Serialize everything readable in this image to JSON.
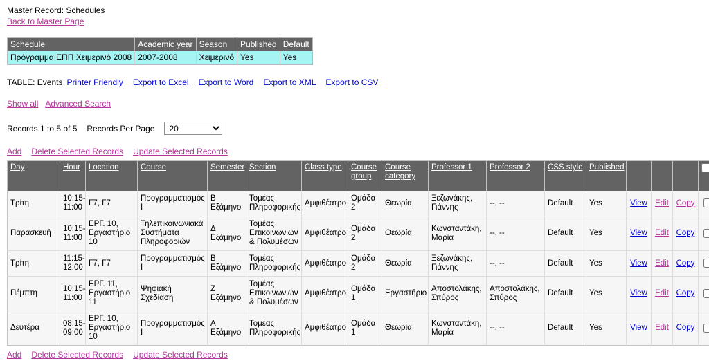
{
  "header": {
    "master_record_label": "Master Record: Schedules",
    "back_link": "Back to Master Page"
  },
  "master_table": {
    "columns": [
      "Schedule",
      "Academic year",
      "Season",
      "Published",
      "Default"
    ],
    "rows": [
      {
        "schedule": "Πρόγραμμα ΕΠΠ Χειμερινό 2008",
        "academic_year": "2007-2008",
        "season": "Χειμερινό",
        "published": "Yes",
        "default": "Yes"
      }
    ],
    "row_bg": "#a6f4f4",
    "header_bg": "#636363"
  },
  "toolbar": {
    "table_label": "TABLE: Events",
    "links": [
      "Printer Friendly",
      "Export to Excel",
      "Export to Word",
      "Export to XML",
      "Export to CSV"
    ]
  },
  "search_bar": {
    "show_all": "Show all",
    "advanced_search": "Advanced Search"
  },
  "records_bar": {
    "records_count": "Records 1 to 5 of 5",
    "records_per_page_label": "Records Per Page",
    "records_per_page_value": "20",
    "records_per_page_options": [
      "20"
    ]
  },
  "actions_top": {
    "add": "Add",
    "delete_selected": "Delete Selected Records",
    "update_selected": "Update Selected Records"
  },
  "actions_bottom": {
    "add": "Add",
    "delete_selected": "Delete Selected Records",
    "update_selected": "Update Selected Records"
  },
  "events_table": {
    "columns": [
      "Day",
      "Hour",
      "Location",
      "Course",
      "Semester",
      "Section",
      "Class type",
      "Course group",
      "Course category",
      "Professor 1",
      "Professor 2",
      "CSS style",
      "Published"
    ],
    "action_labels": {
      "view": "View",
      "edit": "Edit",
      "copy": "Copy"
    },
    "rows": [
      {
        "day": "Τρίτη",
        "hour": "10:15-11:00",
        "location": "Γ7, Γ7",
        "course": "Προγραμματισμός Ι",
        "semester": "Β Εξάμηνο",
        "section": "Τομέας Πληροφορικής",
        "class_type": "Αμφιθέατρο",
        "course_group": "Ομάδα 2",
        "course_category": "Θεωρία",
        "professor1": "Ξεζωνάκης, Γιάννης",
        "professor2": "--, --",
        "css_style": "Default",
        "published": "Yes",
        "view": "View",
        "edit": "Edit",
        "copy": "Copy",
        "copy_visited": true,
        "checked": false
      },
      {
        "day": "Παρασκευή",
        "hour": "10:15-11:00",
        "location": "ΕΡΓ. 10, Εργαστήριο 10",
        "course": "Τηλεπικοινωνιακά Συστήματα Πληροφοριών",
        "semester": "Δ Εξάμηνο",
        "section": "Τομέας Επικοινωνιών & Πολυμέσων",
        "class_type": "Αμφιθέατρο",
        "course_group": "Ομάδα 2",
        "course_category": "Θεωρία",
        "professor1": "Κωνσταντάκη, Μαρία",
        "professor2": "--, --",
        "css_style": "Default",
        "published": "Yes",
        "view": "View",
        "edit": "Edit",
        "copy": "Copy",
        "copy_visited": false,
        "checked": false
      },
      {
        "day": "Τρίτη",
        "hour": "11:15-12:00",
        "location": "Γ7, Γ7",
        "course": "Προγραμματισμός Ι",
        "semester": "Β Εξάμηνο",
        "section": "Τομέας Πληροφορικής",
        "class_type": "Αμφιθέατρο",
        "course_group": "Ομάδα 2",
        "course_category": "Θεωρία",
        "professor1": "Ξεζωνάκης, Γιάννης",
        "professor2": "--, --",
        "css_style": "Default",
        "published": "Yes",
        "view": "View",
        "edit": "Edit",
        "copy": "Copy",
        "copy_visited": false,
        "checked": false
      },
      {
        "day": "Πέμπτη",
        "hour": "10:15-11:00",
        "location": "ΕΡΓ. 11, Εργαστήριο 11",
        "course": "Ψηφιακή Σχεδίαση",
        "semester": "Ζ Εξάμηνο",
        "section": "Τομέας Επικοινωνιών & Πολυμέσων",
        "class_type": "Αμφιθέατρο",
        "course_group": "Ομάδα 1",
        "course_category": "Εργαστήριο",
        "professor1": "Αποστολάκης, Σπύρος",
        "professor2": "Αποστολάκης, Σπύρος",
        "css_style": "Default",
        "published": "Yes",
        "view": "View",
        "edit": "Edit",
        "copy": "Copy",
        "copy_visited": false,
        "checked": false
      },
      {
        "day": "Δευτέρα",
        "hour": "08:15-09:00",
        "location": "ΕΡΓ. 10, Εργαστήριο 10",
        "course": "Προγραμματισμός Ι",
        "semester": "Α Εξάμηνο",
        "section": "Τομέας Πληροφορικής",
        "class_type": "Αμφιθέατρο",
        "course_group": "Ομάδα 1",
        "course_category": "Θεωρία",
        "professor1": "Κωνσταντάκη, Μαρία",
        "professor2": "--, --",
        "css_style": "Default",
        "published": "Yes",
        "view": "View",
        "edit": "Edit",
        "copy": "Copy",
        "copy_visited": false,
        "checked": false
      }
    ]
  },
  "colors": {
    "link": "#0000cc",
    "visited_link": "#b5359b",
    "header_bg": "#636363",
    "master_row_bg": "#a6f4f4",
    "row_bg": "#f6f6f6"
  }
}
